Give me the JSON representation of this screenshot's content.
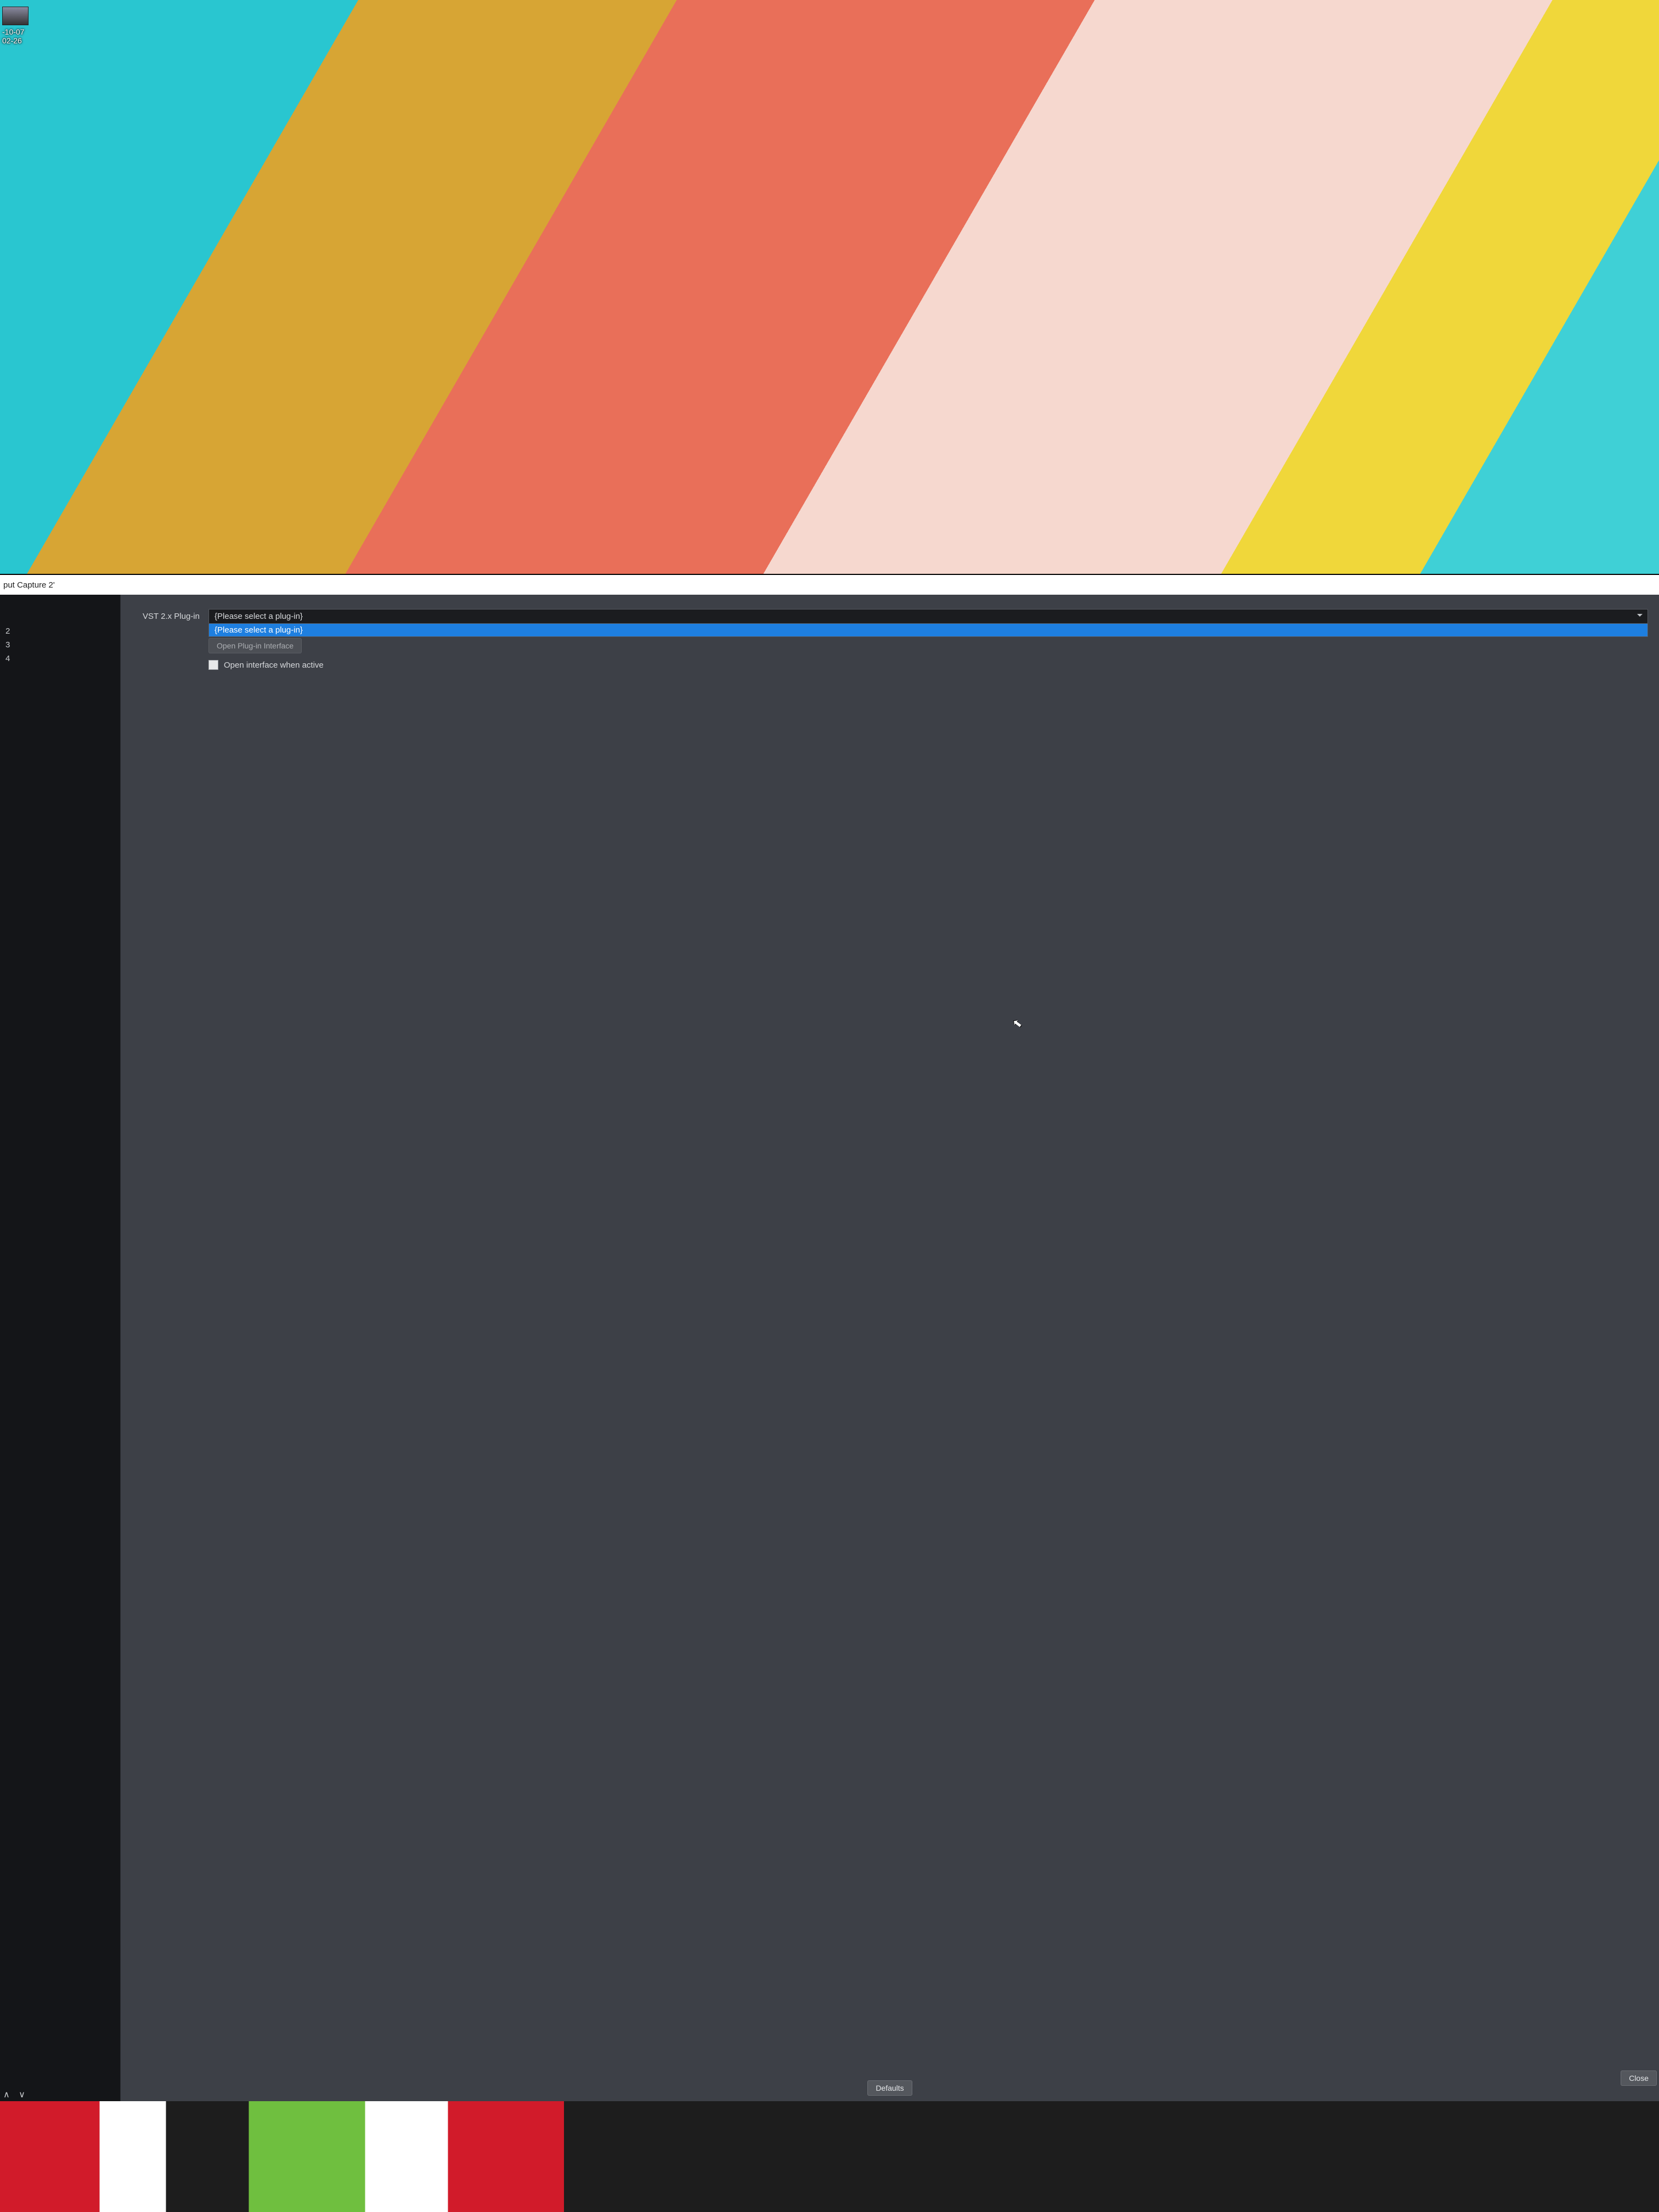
{
  "desktop": {
    "icon_label_line1": "-10-07",
    "icon_label_line2": "02-26"
  },
  "window": {
    "title_fragment": "put Capture 2'"
  },
  "sidebar": {
    "rows": [
      "2",
      "3",
      "4"
    ]
  },
  "form": {
    "plugin_label": "VST 2.x Plug-in",
    "plugin_placeholder": "{Please select a plug-in}",
    "plugin_dropdown_option": "{Please select a plug-in}",
    "open_interface_button": "Open Plug-in Interface",
    "open_when_active_label": "Open interface when active"
  },
  "buttons": {
    "defaults": "Defaults",
    "close": "Close"
  }
}
